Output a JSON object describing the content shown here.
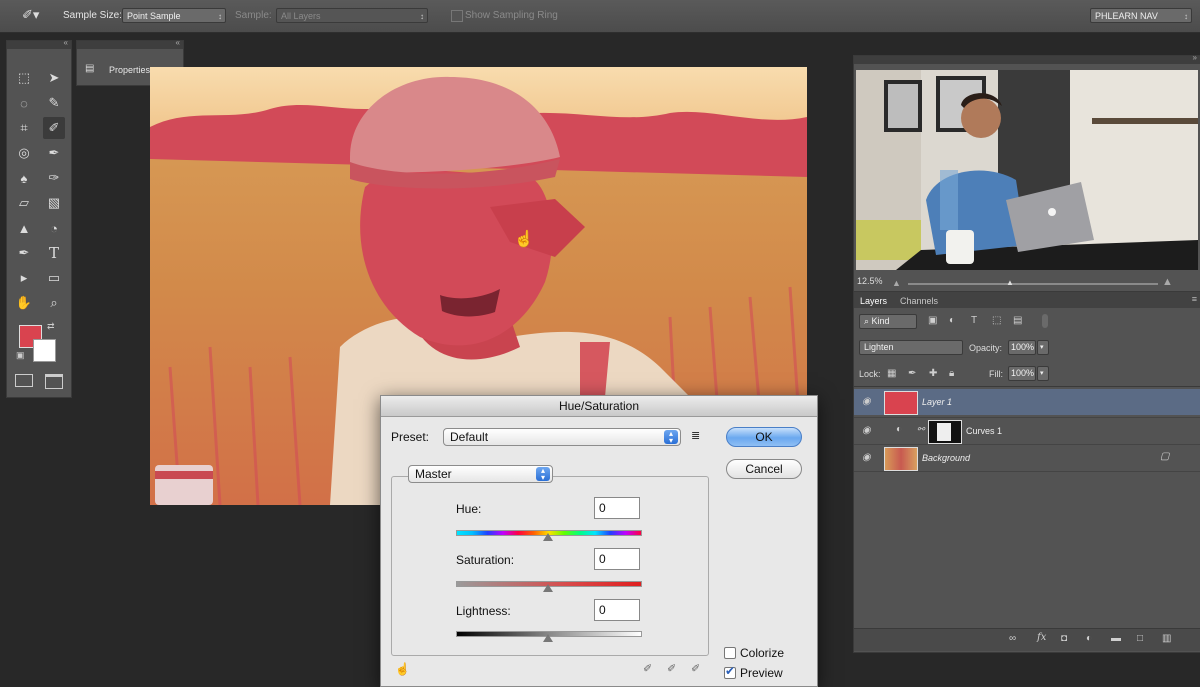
{
  "options_bar": {
    "sample_size_label": "Sample Size:",
    "sample_size_value": "Point Sample",
    "sample_label": "Sample:",
    "sample_value": "All Layers",
    "show_sampling_ring_label": "Show Sampling Ring",
    "workspace_value": "PHLEARN NAV"
  },
  "properties_panel": {
    "title": "Properties"
  },
  "colors": {
    "foreground": "#d9434f",
    "background": "#ffffff",
    "layer1_fill": "#d9434f"
  },
  "navigator": {
    "zoom": "12.5%"
  },
  "layers_panel": {
    "tabs": [
      "Layers",
      "Channels"
    ],
    "filter_value": "Kind",
    "blend_mode": "Lighten",
    "opacity_label": "Opacity:",
    "opacity_value": "100%",
    "lock_label": "Lock:",
    "fill_label": "Fill:",
    "fill_value": "100%",
    "layers": [
      {
        "name": "Layer 1"
      },
      {
        "name": "Curves 1"
      },
      {
        "name": "Background"
      }
    ]
  },
  "dialog": {
    "title": "Hue/Saturation",
    "preset_label": "Preset:",
    "preset_value": "Default",
    "ok_label": "OK",
    "cancel_label": "Cancel",
    "channel_value": "Master",
    "hue_label": "Hue:",
    "hue_value": "0",
    "saturation_label": "Saturation:",
    "saturation_value": "0",
    "lightness_label": "Lightness:",
    "lightness_value": "0",
    "colorize_label": "Colorize",
    "preview_label": "Preview",
    "colorize_checked": false,
    "preview_checked": true
  }
}
